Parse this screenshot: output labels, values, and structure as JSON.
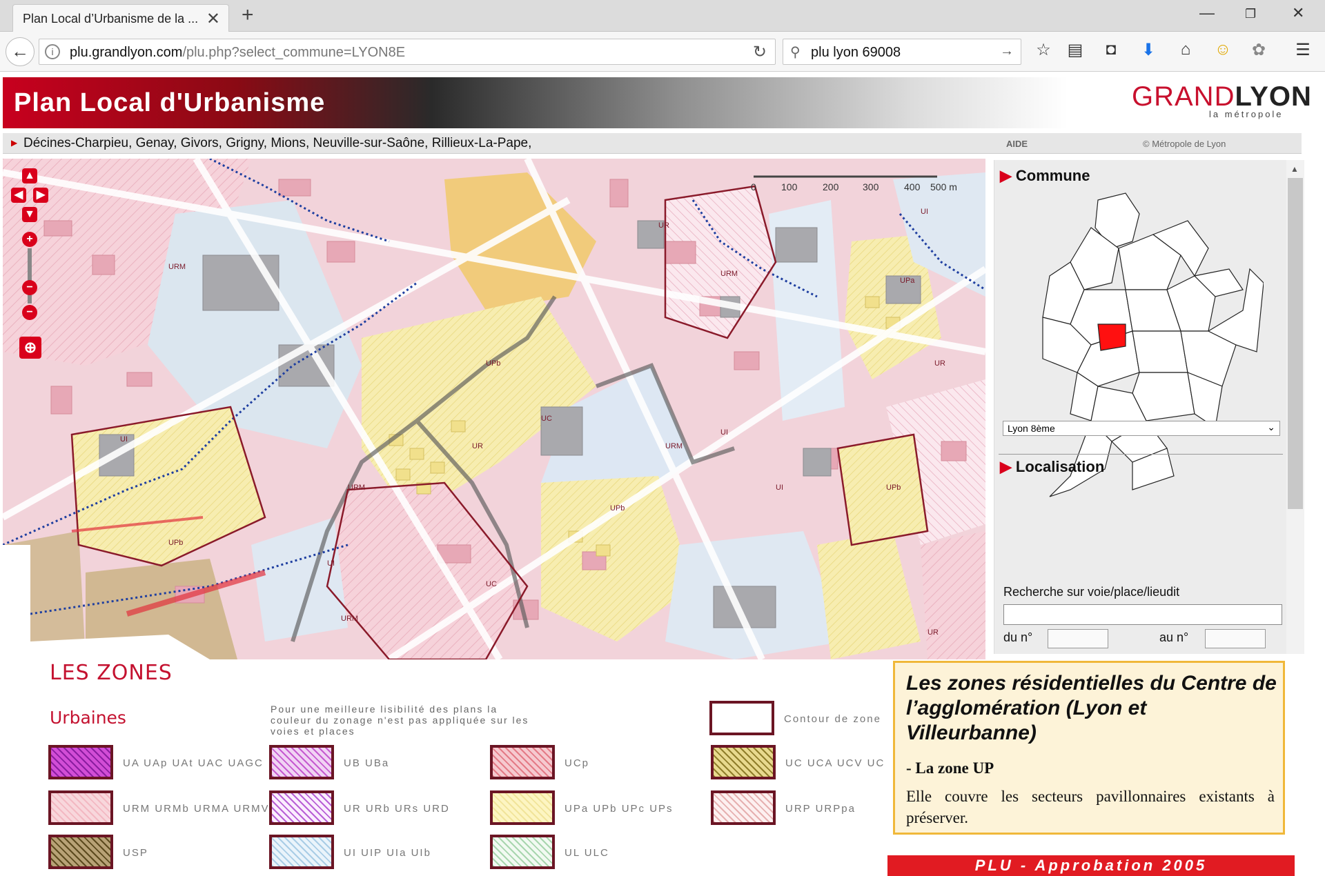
{
  "browser": {
    "tab_title": "Plan Local d’Urbanisme de la ...",
    "url_host": "plu.grandlyon.com",
    "url_path": "/plu.php?select_commune=LYON8E",
    "search_query": "plu lyon 69008",
    "accent": "#d9001b"
  },
  "header": {
    "title": "Plan Local d'Urbanisme",
    "logo_grand": "GRAND",
    "logo_lyon": "LYON",
    "logo_sub": "la métropole",
    "communes_text": "Décines-Charpieu, Genay, Givors, Grigny, Mions, Neuville-sur-Saône, Rillieux-La-Pape,",
    "help": "AIDE",
    "copyright": "© Métropole de Lyon"
  },
  "map": {
    "scale_ticks": [
      "0",
      "100",
      "200",
      "300",
      "400",
      "500 m"
    ],
    "zone_labels": [
      "URM",
      "UI",
      "URM",
      "UR",
      "UPb",
      "UC",
      "UI",
      "URM",
      "UR",
      "UPb",
      "UPa",
      "UI",
      "URM",
      "UR",
      "UPb",
      "UC",
      "UI",
      "URM",
      "UI",
      "UR",
      "UPb"
    ]
  },
  "panel": {
    "commune_heading": "Commune",
    "commune_selected": "Lyon 8ème",
    "localisation_heading": "Localisation",
    "search_label": "Recherche sur voie/place/lieudit",
    "from_label": "du n°",
    "to_label": "au n°"
  },
  "legend": {
    "title": "LES ZONES",
    "subtitle": "Urbaines",
    "note": "Pour une meilleure lisibilité des plans la couleur du zonage n'est pas appliquée sur les voies et places",
    "contour_label": "Contour de zone",
    "zones": [
      {
        "label": "UA UAp UAt UAC UAGC",
        "color": "#d24dd6",
        "hatch": "#8a1da0"
      },
      {
        "label": "UB UBa",
        "color": "#f1d3f4",
        "hatch": "#c65ad0"
      },
      {
        "label": "UCp",
        "color": "#f6c9cf",
        "hatch": "#e47a86"
      },
      {
        "label": "UC UCA UCV UC",
        "color": "#e8d98e",
        "hatch": "#8f7d2a"
      },
      {
        "label": "URM URMb URMA URMV",
        "color": "#f8d7dc",
        "hatch": "#f3b8c2"
      },
      {
        "label": "UR URb URs URD",
        "color": "#fbeefe",
        "hatch": "#b85fd6"
      },
      {
        "label": "UPa UPb UPc UPs",
        "color": "#fdf5c2",
        "hatch": "#f1e49a"
      },
      {
        "label": "URP URPpa",
        "color": "#fdf0f0",
        "hatch": "#e6b0b0"
      },
      {
        "label": "USP",
        "color": "#b8a276",
        "hatch": "#5c4a1e"
      },
      {
        "label": "UI UIP UIa UIb",
        "color": "#eaf4fb",
        "hatch": "#a9cde6"
      },
      {
        "label": "UL ULC",
        "color": "#f2faf2",
        "hatch": "#a8d6ae"
      }
    ]
  },
  "info": {
    "title": "Les zones résidentielles du Centre de l’agglomération (Lyon et Villeurbanne)",
    "subtitle": "- La zone UP",
    "body": "Elle couvre les secteurs pavillonnaires existants à préserver."
  },
  "footer": {
    "approval": "PLU - Approbation 2005"
  }
}
